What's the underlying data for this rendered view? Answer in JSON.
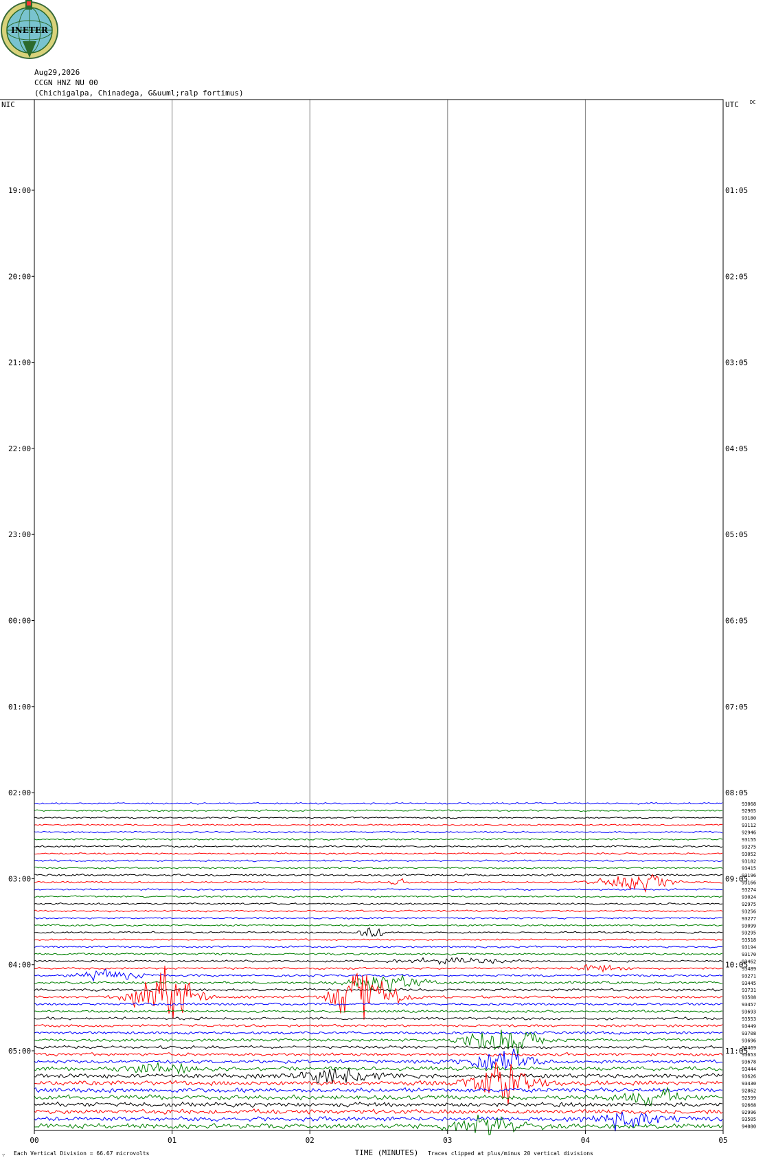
{
  "logo": {
    "text": "INETER",
    "icon": "ineter-globe-logo-icon"
  },
  "header": {
    "date": "Aug29,2026",
    "station": "CCGN HNZ NU 00",
    "location": "(Chichigalpa, Chinadega, G&uuml;ralp fortimus)"
  },
  "labels": {
    "left_zone": "NIC",
    "right_zone": "UTC",
    "dc": "DC",
    "x_axis_title": "TIME (MINUTES)",
    "vertical_division": "Each Vertical Division =   66.67 microvolts",
    "clip_note": "Traces clipped at plus/minus 20 vertical divisions",
    "corner_mark": "∵"
  },
  "colors": {
    "trace_cycle": [
      "#0000ff",
      "#008000",
      "#000000",
      "#ff0000"
    ],
    "grid": "#808080",
    "frame": "#000000"
  },
  "chart_data": {
    "type": "line",
    "title": "",
    "xlabel": "TIME (MINUTES)",
    "xlim": [
      0,
      5
    ],
    "x_ticks": [
      "00",
      "01",
      "02",
      "03",
      "04",
      "05"
    ],
    "left_time_labels": [
      "19:00",
      "20:00",
      "21:00",
      "22:00",
      "23:00",
      "00:00",
      "01:00",
      "02:00",
      "03:00",
      "04:00",
      "05:00"
    ],
    "right_time_labels": [
      "01:05",
      "02:05",
      "03:05",
      "04:05",
      "05:05",
      "06:05",
      "07:05",
      "08:05",
      "09:05",
      "10:05",
      "11:05"
    ],
    "rows_per_hour": 12,
    "first_trace_offset_rows": 1.5,
    "row_counts": [
      "93068",
      "92965",
      "93180",
      "93112",
      "92946",
      "93155",
      "93275",
      "93052",
      "93182",
      "93415",
      "93196",
      "93166",
      "93274",
      "93024",
      "92975",
      "93256",
      "93277",
      "93099",
      "93295",
      "93518",
      "93194",
      "93170",
      "93462",
      "93489",
      "93271",
      "93445",
      "93731",
      "93508",
      "93457",
      "93693",
      "93553",
      "93449",
      "93708",
      "93696",
      "93469",
      "93653",
      "93678",
      "93444",
      "93626",
      "93430",
      "92862",
      "92599",
      "92668",
      "92996",
      "93505",
      "94080"
    ],
    "events": [
      {
        "row": 11,
        "minute": 4.35,
        "width_min": 0.35,
        "amplitude_div": 3.5
      },
      {
        "row": 11,
        "minute": 2.65,
        "width_min": 0.08,
        "amplitude_div": 1.5
      },
      {
        "row": 18,
        "minute": 2.45,
        "width_min": 0.12,
        "amplitude_div": 3.0
      },
      {
        "row": 22,
        "minute": 3.05,
        "width_min": 0.5,
        "amplitude_div": 1.2
      },
      {
        "row": 23,
        "minute": 4.1,
        "width_min": 0.25,
        "amplitude_div": 1.5
      },
      {
        "row": 24,
        "minute": 0.55,
        "width_min": 0.3,
        "amplitude_div": 2.0
      },
      {
        "row": 25,
        "minute": 2.55,
        "width_min": 0.35,
        "amplitude_div": 3.5
      },
      {
        "row": 27,
        "minute": 0.95,
        "width_min": 0.3,
        "amplitude_div": 12
      },
      {
        "row": 27,
        "minute": 2.4,
        "width_min": 0.3,
        "amplitude_div": 12
      },
      {
        "row": 33,
        "minute": 3.4,
        "width_min": 0.35,
        "amplitude_div": 6
      },
      {
        "row": 36,
        "minute": 3.4,
        "width_min": 0.3,
        "amplitude_div": 5
      },
      {
        "row": 37,
        "minute": 0.9,
        "width_min": 0.3,
        "amplitude_div": 2.5
      },
      {
        "row": 38,
        "minute": 2.2,
        "width_min": 0.4,
        "amplitude_div": 3
      },
      {
        "row": 39,
        "minute": 3.4,
        "width_min": 0.3,
        "amplitude_div": 8
      },
      {
        "row": 41,
        "minute": 4.5,
        "width_min": 0.3,
        "amplitude_div": 3
      },
      {
        "row": 44,
        "minute": 4.3,
        "width_min": 0.35,
        "amplitude_div": 4
      },
      {
        "row": 45,
        "minute": 3.3,
        "width_min": 0.4,
        "amplitude_div": 4
      }
    ],
    "background_noise_div": [
      0.35,
      0.35,
      0.3,
      0.3,
      0.35,
      0.35,
      0.35,
      0.35,
      0.35,
      0.35,
      0.4,
      0.35,
      0.35,
      0.35,
      0.35,
      0.35,
      0.35,
      0.35,
      0.35,
      0.35,
      0.4,
      0.4,
      0.4,
      0.4,
      0.45,
      0.5,
      0.5,
      0.5,
      0.5,
      0.5,
      0.55,
      0.5,
      0.55,
      0.6,
      0.6,
      0.6,
      0.7,
      0.8,
      0.9,
      0.9,
      0.9,
      0.9,
      0.9,
      0.9,
      0.9,
      0.9
    ]
  }
}
